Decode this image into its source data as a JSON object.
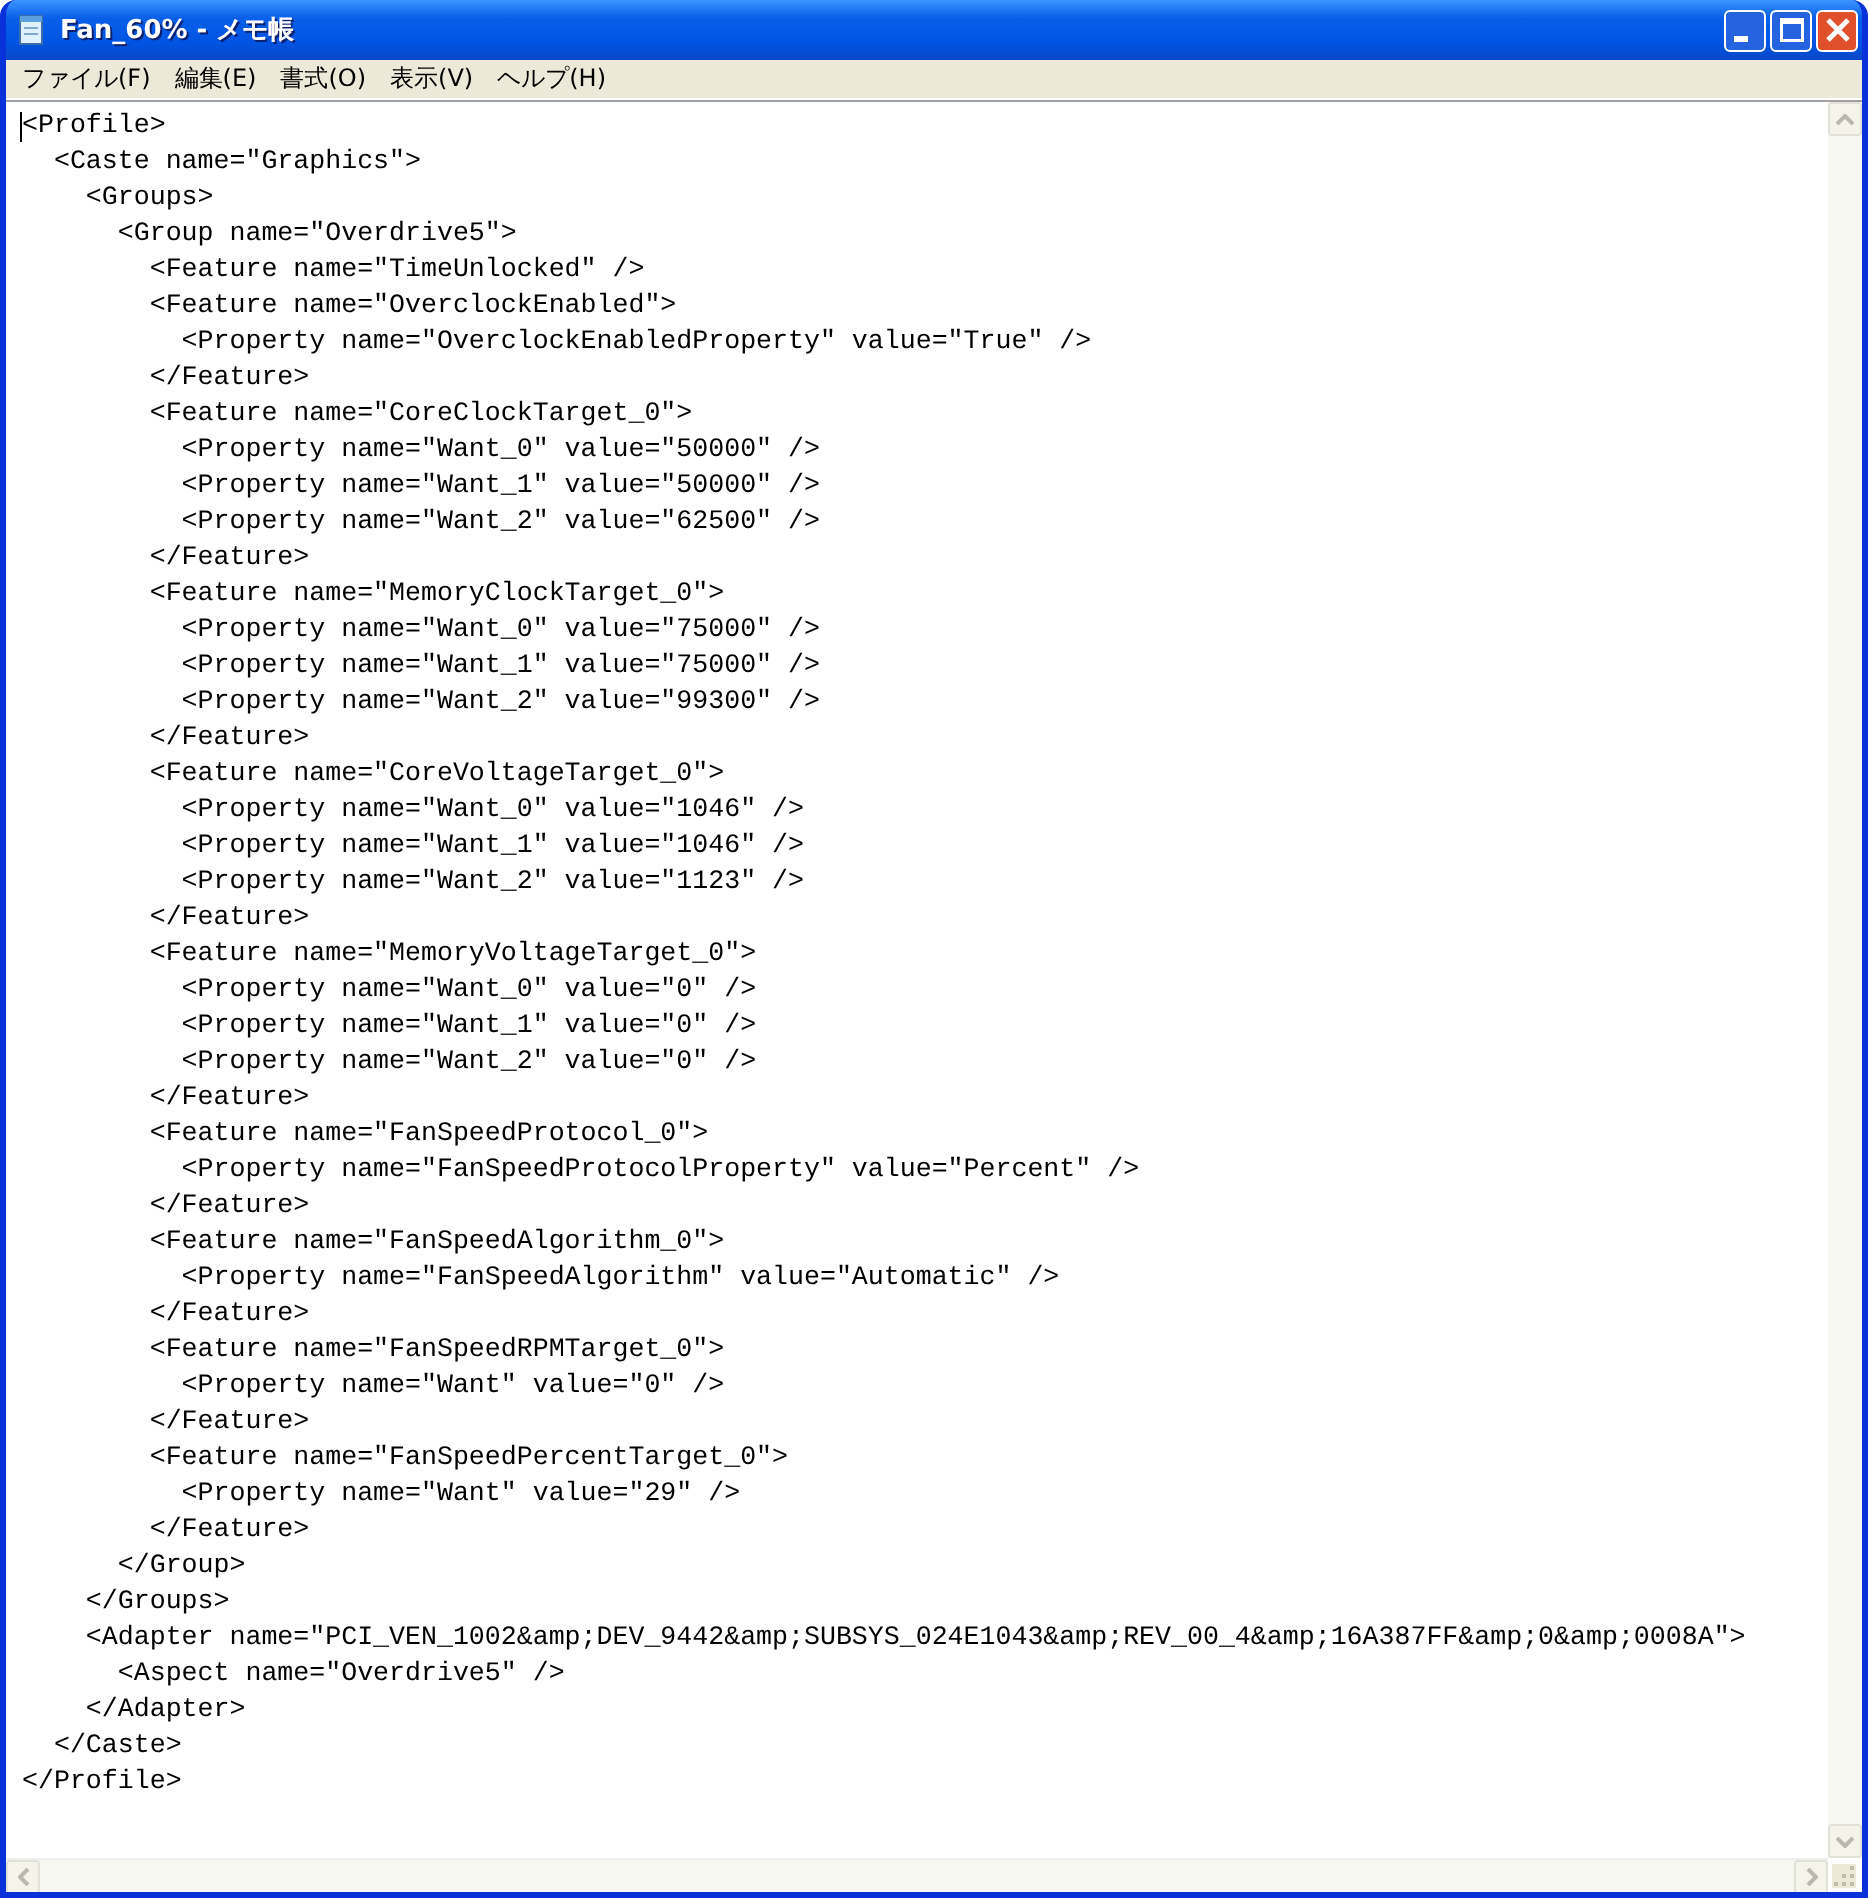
{
  "window": {
    "title": "Fan_60% - メモ帳"
  },
  "menu": [
    "ファイル(F)",
    "編集(E)",
    "書式(O)",
    "表示(V)",
    "ヘルプ(H)"
  ],
  "document": {
    "lines": [
      "<Profile>",
      "  <Caste name=\"Graphics\">",
      "    <Groups>",
      "      <Group name=\"Overdrive5\">",
      "        <Feature name=\"TimeUnlocked\" />",
      "        <Feature name=\"OverclockEnabled\">",
      "          <Property name=\"OverclockEnabledProperty\" value=\"True\" />",
      "        </Feature>",
      "        <Feature name=\"CoreClockTarget_0\">",
      "          <Property name=\"Want_0\" value=\"50000\" />",
      "          <Property name=\"Want_1\" value=\"50000\" />",
      "          <Property name=\"Want_2\" value=\"62500\" />",
      "        </Feature>",
      "        <Feature name=\"MemoryClockTarget_0\">",
      "          <Property name=\"Want_0\" value=\"75000\" />",
      "          <Property name=\"Want_1\" value=\"75000\" />",
      "          <Property name=\"Want_2\" value=\"99300\" />",
      "        </Feature>",
      "        <Feature name=\"CoreVoltageTarget_0\">",
      "          <Property name=\"Want_0\" value=\"1046\" />",
      "          <Property name=\"Want_1\" value=\"1046\" />",
      "          <Property name=\"Want_2\" value=\"1123\" />",
      "        </Feature>",
      "        <Feature name=\"MemoryVoltageTarget_0\">",
      "          <Property name=\"Want_0\" value=\"0\" />",
      "          <Property name=\"Want_1\" value=\"0\" />",
      "          <Property name=\"Want_2\" value=\"0\" />",
      "        </Feature>",
      "        <Feature name=\"FanSpeedProtocol_0\">",
      "          <Property name=\"FanSpeedProtocolProperty\" value=\"Percent\" />",
      "        </Feature>",
      "        <Feature name=\"FanSpeedAlgorithm_0\">",
      "          <Property name=\"FanSpeedAlgorithm\" value=\"Automatic\" />",
      "        </Feature>",
      "        <Feature name=\"FanSpeedRPMTarget_0\">",
      "          <Property name=\"Want\" value=\"0\" />",
      "        </Feature>",
      "        <Feature name=\"FanSpeedPercentTarget_0\">",
      "          <Property name=\"Want\" value=\"29\" />",
      "        </Feature>",
      "      </Group>",
      "    </Groups>",
      "    <Adapter name=\"PCI_VEN_1002&amp;DEV_9442&amp;SUBSYS_024E1043&amp;REV_00_4&amp;16A387FF&amp;0&amp;0008A\">",
      "      <Aspect name=\"Overdrive5\" />",
      "    </Adapter>",
      "  </Caste>",
      "</Profile>"
    ]
  }
}
